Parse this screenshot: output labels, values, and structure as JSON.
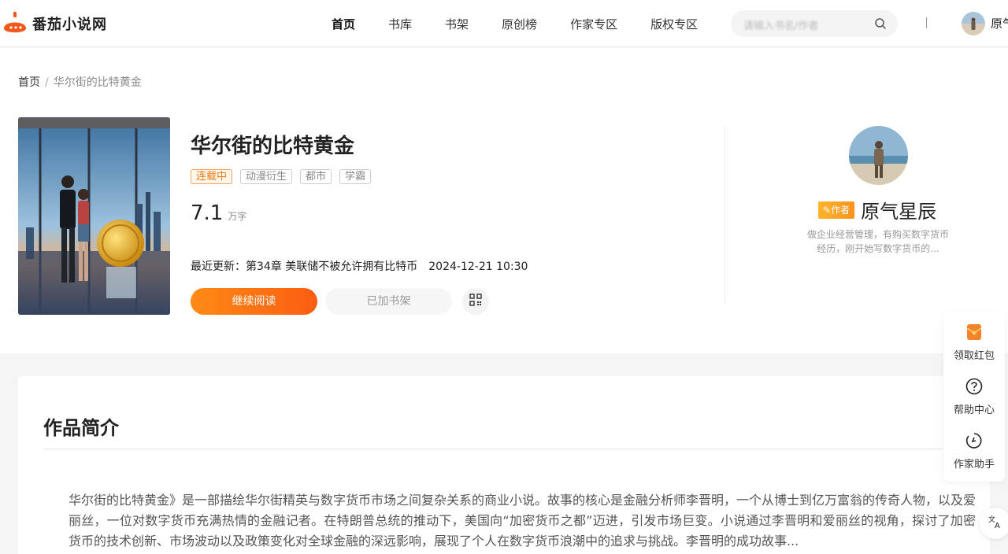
{
  "header": {
    "logo_text": "番茄小说网",
    "nav": [
      {
        "label": "首页",
        "active": true
      },
      {
        "label": "书库"
      },
      {
        "label": "书架"
      },
      {
        "label": "原创榜"
      },
      {
        "label": "作家专区"
      },
      {
        "label": "版权专区"
      }
    ],
    "search_placeholder": "请输入书名/作者",
    "user_name": "原气"
  },
  "breadcrumb": {
    "home": "首页",
    "separator": "/",
    "current": "华尔街的比特黄金"
  },
  "book": {
    "title": "华尔街的比特黄金",
    "status": "连载中",
    "tags": [
      "动漫衍生",
      "都市",
      "学霸"
    ],
    "word_count": "7.1",
    "word_unit": "万字",
    "latest_label": "最近更新：",
    "latest_chapter": "第34章 美联储不被允许拥有比特币",
    "latest_date": "2024-12-21 10:30",
    "read_button": "继续阅读",
    "shelf_button": "已加书架"
  },
  "author": {
    "badge": "作者",
    "name": "原气星辰",
    "desc": "做企业经营管理，有购买数字货币经历，刚开始写数字货币的..."
  },
  "intro": {
    "title": "作品简介",
    "text": "华尔街的比特黄金》是一部描绘华尔街精英与数字货币市场之间复杂关系的商业小说。故事的核心是金融分析师李晋明，一个从博士到亿万富翁的传奇人物，以及爱丽丝，一位对数字货币充满热情的金融记者。在特朗普总统的推动下，美国向“加密货币之都”迈进，引发市场巨变。小说通过李晋明和爱丽丝的视角，探讨了加密货币的技术创新、市场波动以及政策变化对全球金融的深远影响，展现了个人在数字货币浪潮中的追求与挑战。李晋明的成功故事..."
  },
  "sidebar": {
    "items": [
      {
        "label": "领取红包",
        "icon": "red-envelope-icon"
      },
      {
        "label": "帮助中心",
        "icon": "help-circle-icon"
      },
      {
        "label": "作家助手",
        "icon": "writer-assistant-icon"
      }
    ]
  },
  "colors": {
    "accent": "#fb6a12",
    "status": "#f07a12",
    "badge": "#f7941d"
  }
}
